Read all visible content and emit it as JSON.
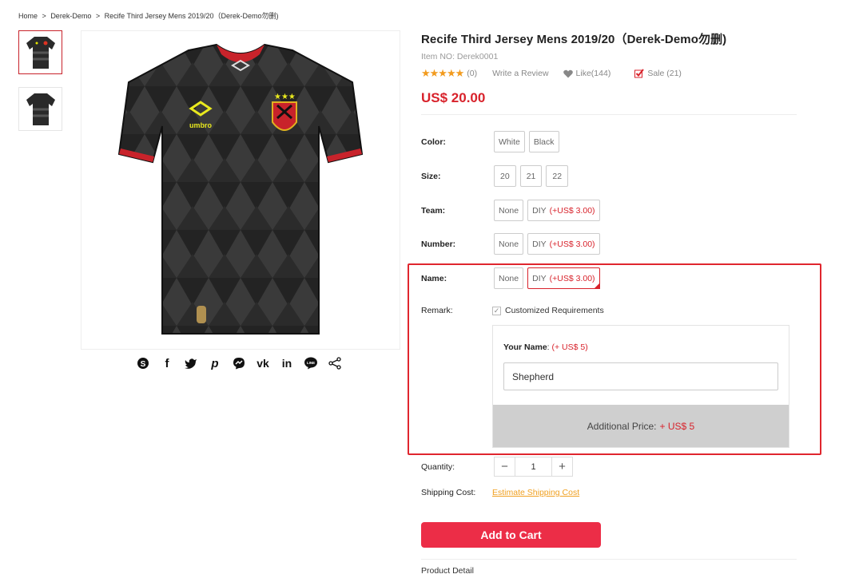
{
  "breadcrumb": {
    "home": "Home",
    "sep1": ">",
    "category": "Derek-Demo",
    "sep2": ">",
    "current": "Recife Third Jersey Mens 2019/20（Derek-Demo勿删)"
  },
  "gallery": {
    "thumbnails": [
      "jersey-front",
      "jersey-back"
    ],
    "main_image": "black-patterned-football-jersey"
  },
  "share_icons": [
    "skype-icon",
    "facebook-icon",
    "twitter-icon",
    "pinterest-icon",
    "messenger-icon",
    "vk-icon",
    "linkedin-icon",
    "line-icon",
    "share-icon"
  ],
  "product": {
    "title": "Recife Third Jersey Mens 2019/20（Derek-Demo勿删)",
    "item_no": "Item NO: Derek0001",
    "stars": "★★★★★",
    "review_count": "(0)",
    "write_review": "Write a Review",
    "like": "Like(144)",
    "sale": "Sale (21)",
    "price": "US$ 20.00"
  },
  "options": {
    "color": {
      "label": "Color:",
      "values": [
        "White",
        "Black"
      ]
    },
    "size": {
      "label": "Size:",
      "values": [
        "20",
        "21",
        "22"
      ]
    },
    "team": {
      "label": "Team:",
      "none": "None",
      "diy": "DIY",
      "diy_price": "(+US$ 3.00)"
    },
    "number": {
      "label": "Number:",
      "none": "None",
      "diy": "DIY",
      "diy_price": "(+US$ 3.00)"
    },
    "name": {
      "label": "Name:",
      "none": "None",
      "diy": "DIY",
      "diy_price": "(+US$ 3.00)"
    }
  },
  "remark": {
    "label": "Remark:",
    "checkbox_label": "Customized Requirements",
    "checked": true
  },
  "custom": {
    "field_label": "Your Name",
    "field_colon": ":",
    "field_price": "(+ US$ 5)",
    "field_value": "Shepherd",
    "additional_label": "Additional Price:",
    "additional_value": "+ US$ 5"
  },
  "quantity": {
    "label": "Quantity:",
    "minus": "−",
    "value": "1",
    "plus": "+"
  },
  "shipping": {
    "label": "Shipping Cost:",
    "link": "Estimate Shipping Cost"
  },
  "add_to_cart": "Add to Cart",
  "product_detail": "Product Detail",
  "colors": {
    "accent": "#d8222b",
    "button": "#ec2d47",
    "star": "#f29b1e",
    "link": "#f0a020"
  }
}
